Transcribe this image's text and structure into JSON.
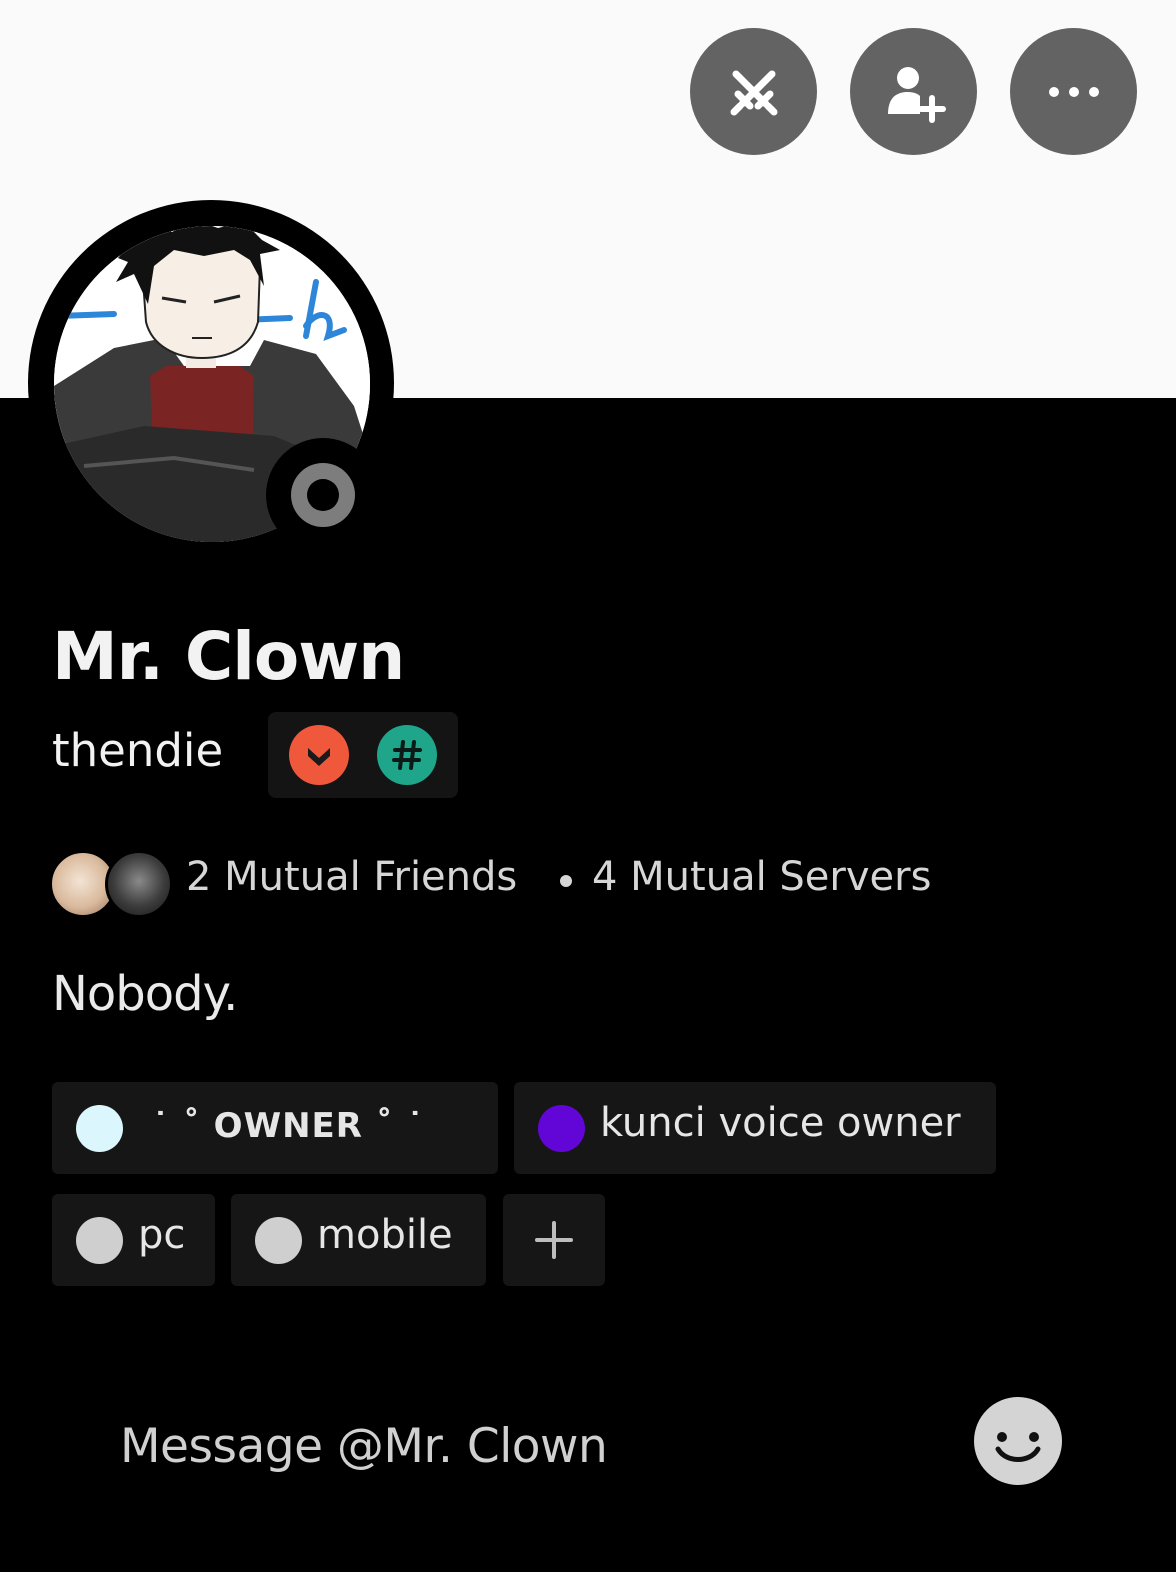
{
  "profile": {
    "display_name": "Mr. Clown",
    "username": "thendie",
    "bio": "Nobody.",
    "status": "offline",
    "status_icon": "status-offline-icon"
  },
  "header": {
    "buttons": [
      {
        "icon": "swords-crossed-icon"
      },
      {
        "icon": "add-friend-icon"
      },
      {
        "icon": "more-icon"
      }
    ]
  },
  "badges": [
    {
      "icon": "chevron-badge-icon",
      "color": "#f0583c"
    },
    {
      "icon": "hashtag-badge-icon",
      "color": "#1fa58a"
    }
  ],
  "mutual": {
    "friends_label": "2 Mutual Friends",
    "servers_label": "4 Mutual Servers"
  },
  "roles": [
    {
      "label": "˙ ˚ OWNER ˚ ˙",
      "color": "#dbf6fc"
    },
    {
      "label": "kunci voice owner",
      "color": "#6206d8"
    },
    {
      "label": "pc",
      "color": "#cfcfcf"
    },
    {
      "label": "mobile",
      "color": "#cfcfcf"
    }
  ],
  "add_role_icon": "plus-icon",
  "message": {
    "placeholder": "Message @Mr. Clown",
    "emoji_icon": "emoji-icon"
  },
  "colors": {
    "background": "#000000",
    "banner": "#fafafa",
    "button": "#636363"
  }
}
